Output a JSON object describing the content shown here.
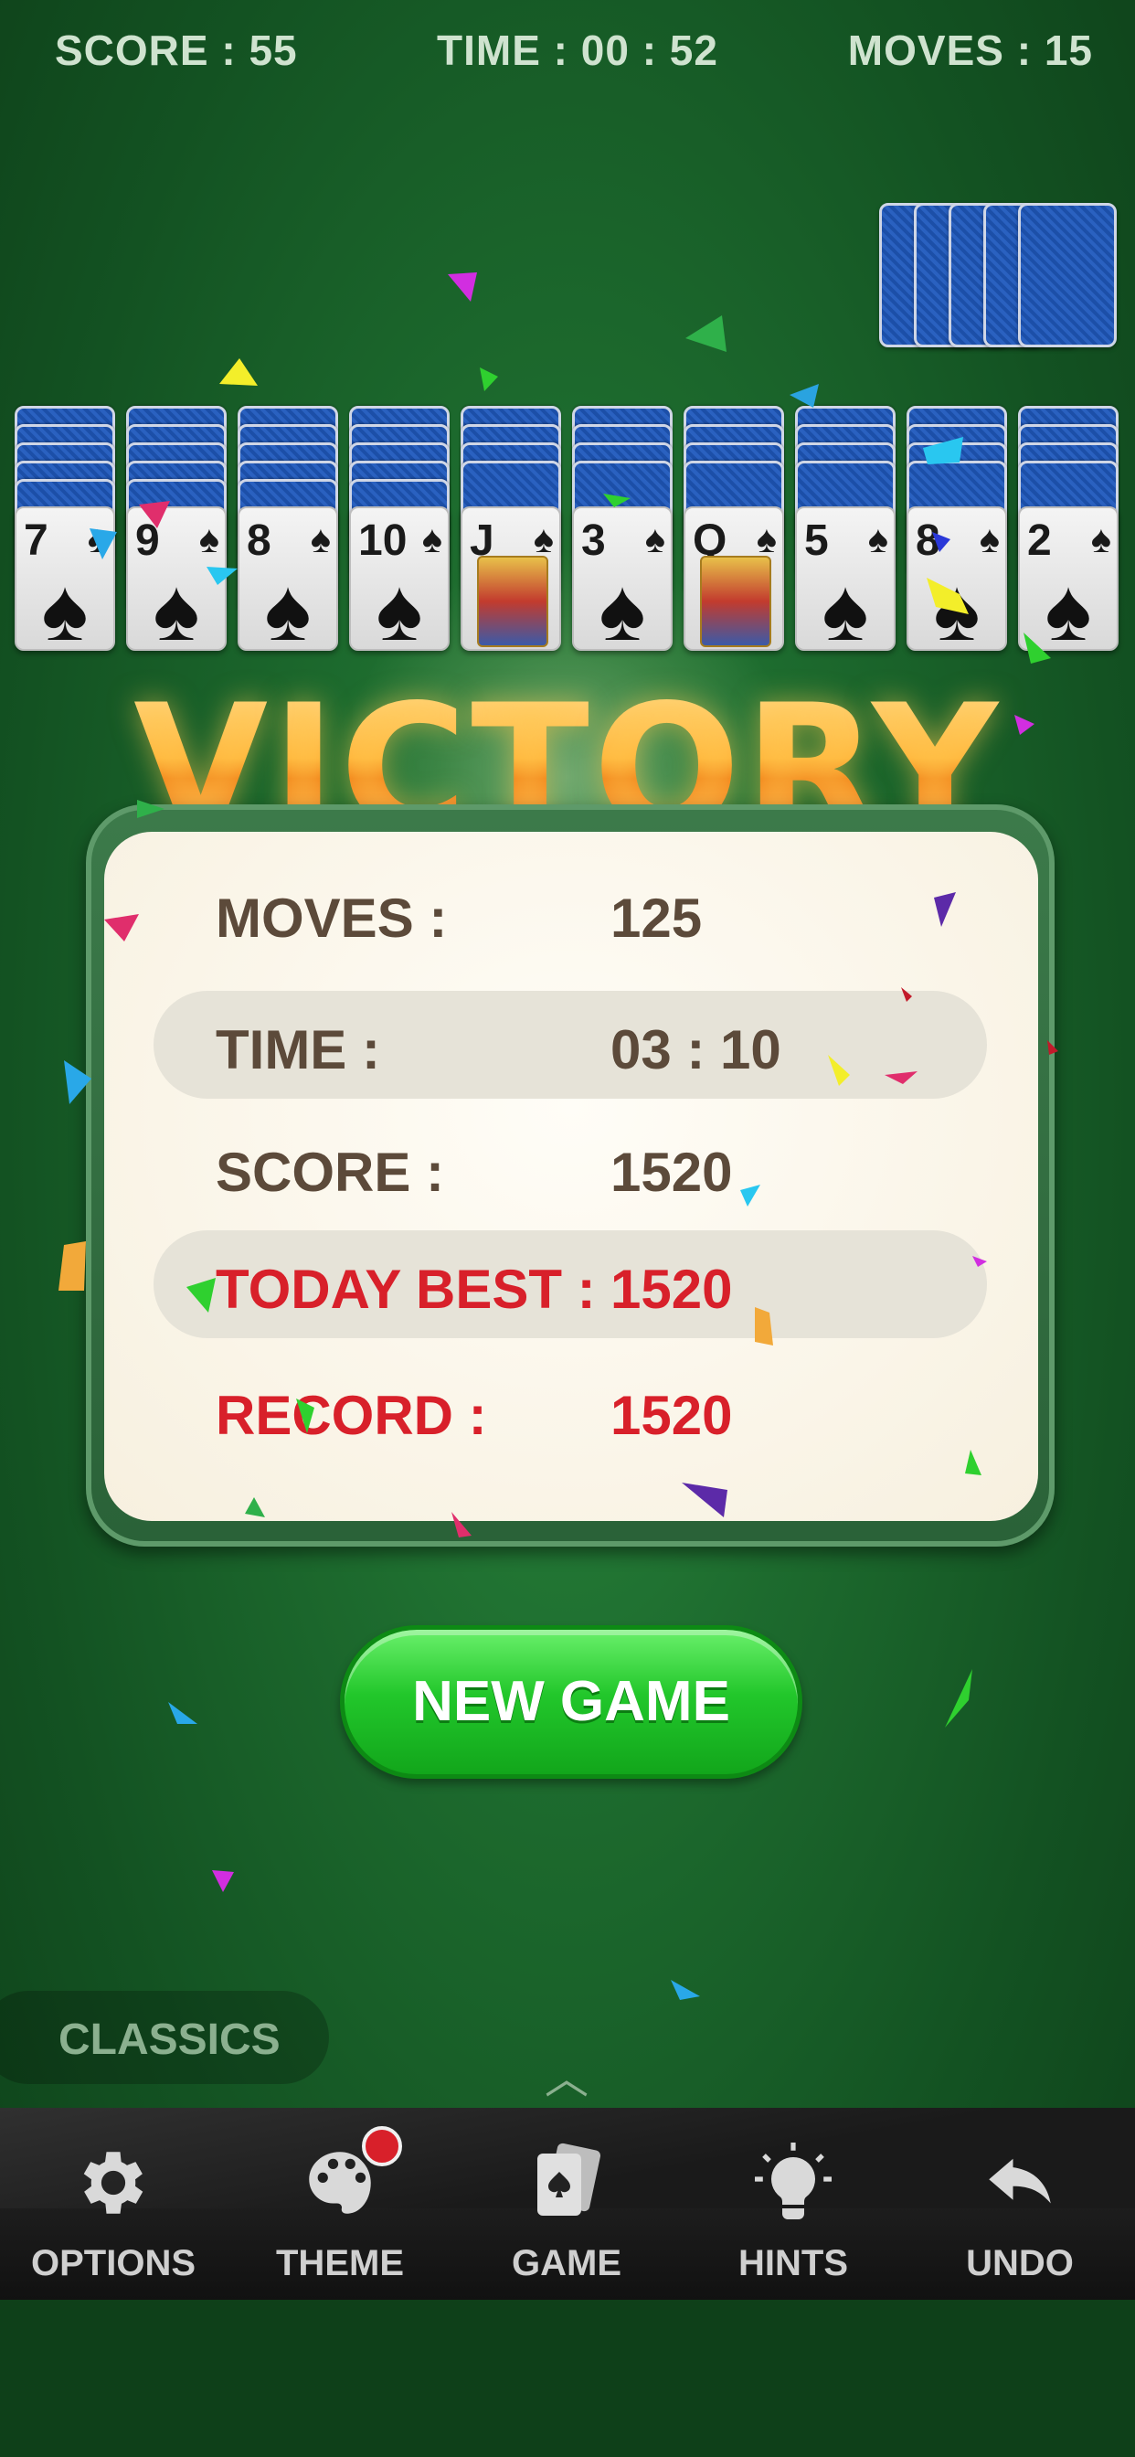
{
  "top": {
    "score": "SCORE : 55",
    "time": "TIME : 00 : 52",
    "moves": "MOVES : 15"
  },
  "tableau": [
    {
      "rank": "7",
      "suit": "♠",
      "facedown": 5
    },
    {
      "rank": "9",
      "suit": "♠",
      "facedown": 5
    },
    {
      "rank": "8",
      "suit": "♠",
      "facedown": 5
    },
    {
      "rank": "10",
      "suit": "♠",
      "facedown": 5
    },
    {
      "rank": "J",
      "suit": "♠",
      "facedown": 4
    },
    {
      "rank": "3",
      "suit": "♠",
      "facedown": 4
    },
    {
      "rank": "Q",
      "suit": "♠",
      "facedown": 4
    },
    {
      "rank": "5",
      "suit": "♠",
      "facedown": 4
    },
    {
      "rank": "8",
      "suit": "♠",
      "facedown": 4
    },
    {
      "rank": "2",
      "suit": "♠",
      "facedown": 4
    }
  ],
  "victory_title": "VICTORY",
  "results": {
    "moves_label": "MOVES :",
    "moves_value": "125",
    "time_label": "TIME :",
    "time_value": "03 : 10",
    "score_label": "SCORE :",
    "score_value": "1520",
    "today_best_label": "TODAY BEST :",
    "today_best_value": "1520",
    "record_label": "RECORD :",
    "record_value": "1520"
  },
  "new_game_label": "NEW GAME",
  "mode_label": "CLASSICS",
  "nav": {
    "options": "OPTIONS",
    "theme": "THEME",
    "game": "GAME",
    "hints": "HINTS",
    "undo": "UNDO"
  },
  "colors": {
    "felt": "#1d6b2e",
    "highlight_red": "#d8202a",
    "button_green": "#22c72b",
    "card_back_blue": "#1c4fa8"
  }
}
